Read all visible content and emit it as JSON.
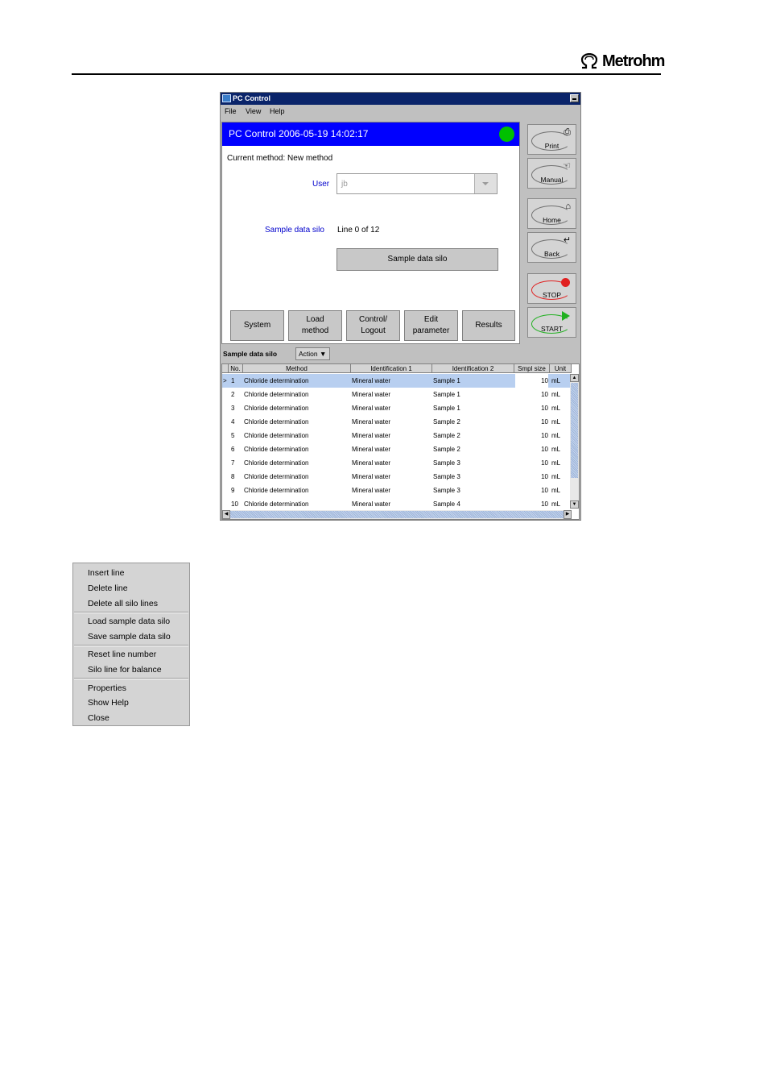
{
  "brand": {
    "name": "Metrohm",
    "logo_icon": "omega-icon"
  },
  "window": {
    "title": "PC Control",
    "menu": [
      "File",
      "View",
      "Help"
    ],
    "header": {
      "text": "PC Control   2006-05-19 14:02:17",
      "status_color": "#00c000"
    },
    "current_method": "Current method: New method",
    "user": {
      "label": "User",
      "value": "jb"
    },
    "silo": {
      "label": "Sample data silo",
      "value": "Line 0 of 12",
      "button": "Sample data silo"
    },
    "tabs": [
      {
        "line1": "System",
        "line2": ""
      },
      {
        "line1": "Load",
        "line2": "method"
      },
      {
        "line1": "Control/",
        "line2": "Logout"
      },
      {
        "line1": "Edit",
        "line2": "parameter"
      },
      {
        "line1": "Results",
        "line2": ""
      }
    ],
    "side_buttons": {
      "print": "Print",
      "manual": "Manual",
      "home": "Home",
      "back": "Back",
      "stop": "STOP",
      "start": "START"
    },
    "silo_bar": {
      "title": "Sample data silo",
      "action": "Action ▼"
    },
    "table": {
      "columns": [
        "No.",
        "Method",
        "Identification 1",
        "Identification 2",
        "Smpl size",
        "Unit"
      ],
      "selected_marker": ">",
      "rows": [
        {
          "no": "1",
          "method": "Chloride determination",
          "id1": "Mineral water",
          "id2": "Sample 1",
          "size": "10",
          "unit": "mL"
        },
        {
          "no": "2",
          "method": "Chloride determination",
          "id1": "Mineral water",
          "id2": "Sample 1",
          "size": "10",
          "unit": "mL"
        },
        {
          "no": "3",
          "method": "Chloride determination",
          "id1": "Mineral water",
          "id2": "Sample 1",
          "size": "10",
          "unit": "mL"
        },
        {
          "no": "4",
          "method": "Chloride determination",
          "id1": "Mineral water",
          "id2": "Sample 2",
          "size": "10",
          "unit": "mL"
        },
        {
          "no": "5",
          "method": "Chloride determination",
          "id1": "Mineral water",
          "id2": "Sample 2",
          "size": "10",
          "unit": "mL"
        },
        {
          "no": "6",
          "method": "Chloride determination",
          "id1": "Mineral water",
          "id2": "Sample 2",
          "size": "10",
          "unit": "mL"
        },
        {
          "no": "7",
          "method": "Chloride determination",
          "id1": "Mineral water",
          "id2": "Sample 3",
          "size": "10",
          "unit": "mL"
        },
        {
          "no": "8",
          "method": "Chloride determination",
          "id1": "Mineral water",
          "id2": "Sample 3",
          "size": "10",
          "unit": "mL"
        },
        {
          "no": "9",
          "method": "Chloride determination",
          "id1": "Mineral water",
          "id2": "Sample 3",
          "size": "10",
          "unit": "mL"
        },
        {
          "no": "10",
          "method": "Chloride determination",
          "id1": "Mineral water",
          "id2": "Sample 4",
          "size": "10",
          "unit": "mL"
        }
      ]
    }
  },
  "context_menu": {
    "groups": [
      [
        "Insert line",
        "Delete line",
        "Delete all silo lines"
      ],
      [
        "Load sample data silo",
        "Save sample data silo"
      ],
      [
        "Reset line number",
        "Silo line for balance"
      ],
      [
        "Properties",
        "Show Help",
        "Close"
      ]
    ]
  }
}
